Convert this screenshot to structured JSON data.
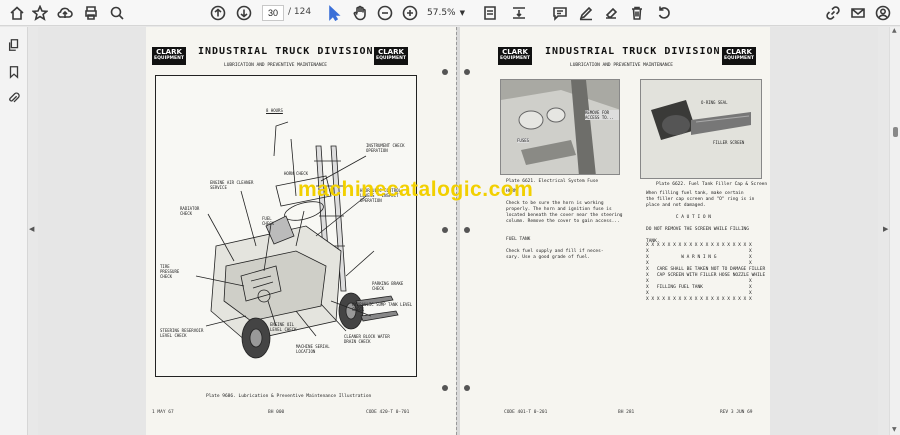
{
  "toolbar": {
    "page_current": "30",
    "page_total": "/ 124",
    "zoom": "57.5%",
    "icons": [
      "home-icon",
      "star-icon",
      "upload-icon",
      "print-icon",
      "zoom-search-icon",
      "prev-page-icon",
      "next-page-icon",
      "select-cursor-icon",
      "hand-icon",
      "zoom-out-icon",
      "zoom-in-icon",
      "fit-page-icon",
      "scroll-mode-icon",
      "comment-icon",
      "draw-icon",
      "erase-icon",
      "delete-icon",
      "share-link-icon",
      "mail-icon",
      "account-icon"
    ]
  },
  "sidebar": {
    "icons": [
      "copy-pages-icon",
      "bookmark-icon",
      "attachment-icon"
    ]
  },
  "left_page": {
    "logo_line1": "CLARK",
    "logo_line2": "EQUIPMENT",
    "title": "INDUSTRIAL TRUCK DIVISION",
    "subtitle": "LUBRICATION AND PREVENTIVE MAINTENANCE",
    "callouts": [
      "8 HOURS",
      "INSTRUMENT CHECK OPERATION",
      "HORN CHECK",
      "ENGINE AIR CLEANER SERVICE",
      "HYDRAULIC CONTROL LEVERS - INSPECT OPERATION",
      "RADIATOR CHECK",
      "FUEL CHECK",
      "TIRE PRESSURE CHECK",
      "PARKING BRAKE CHECK",
      "HYDRAULIC SUMP TANK LEVEL CHECK",
      "STEERING RESERVOIR LEVEL CHECK",
      "ENGINE OIL LEVEL CHECK",
      "MACHINE SERIAL LOCATION",
      "CLEANER BLOCK WATER DRAIN CHECK"
    ],
    "caption": "Plate 9686. Lubrication & Preventive Maintenance Illustration",
    "footer_left": "1 MAY 67",
    "footer_mid": "BH 000",
    "footer_right": "CODE 420-T 0-701"
  },
  "right_page": {
    "logo_line1": "CLARK",
    "logo_line2": "EQUIPMENT",
    "title": "INDUSTRIAL TRUCK DIVISION",
    "subtitle": "LUBRICATION AND PREVENTIVE MAINTENANCE",
    "photo1_labels": [
      "REMOVE FOR ACCESS TO...",
      "FUSES"
    ],
    "photo2_labels": [
      "O-RING SEAL",
      "FILLER SCREEN"
    ],
    "caption1": "Plate 6621. Electrical System Fuse",
    "caption2": "Plate 6622. Fuel Tank Filler Cap & Screen",
    "left_text": "HORN\n\nCheck to be sure the horn is working\nproperly. The horn and ignition fuse is\nlocated beneath the cover near the steering\ncolumn. Remove the cover to gain access...\n\n\nFUEL TANK\n\nCheck fuel supply and fill if neces-\nsary. Use a good grade of fuel.",
    "right_text": "When filling fuel tank, make certain\nthe filler cap screen and \"O\" ring is in\nplace and not damaged.\n\n           C A U T I O N\n\nDO NOT REMOVE THE SCREEN WHILE FILLING\n\nTANK.",
    "warning_text": "X X X X X X X X X X X X X X X X X X X X\nX                                     X\nX            W A R N I N G            X\nX                                     X\nX   CARE SHALL BE TAKEN NOT TO DAMAGE FILLER\nX   CAP SCREEN WITH FILLER HOSE NOZZLE WHILE\nX                                     X\nX   FILLING FUEL TANK                 X\nX                                     X\nX X X X X X X X X X X X X X X X X X X X",
    "footer_left": "CODE 401-T 0-201",
    "footer_mid": "BH 281",
    "footer_right": "REV 3 JUN 69"
  },
  "watermark": "machinecatalogic.com"
}
